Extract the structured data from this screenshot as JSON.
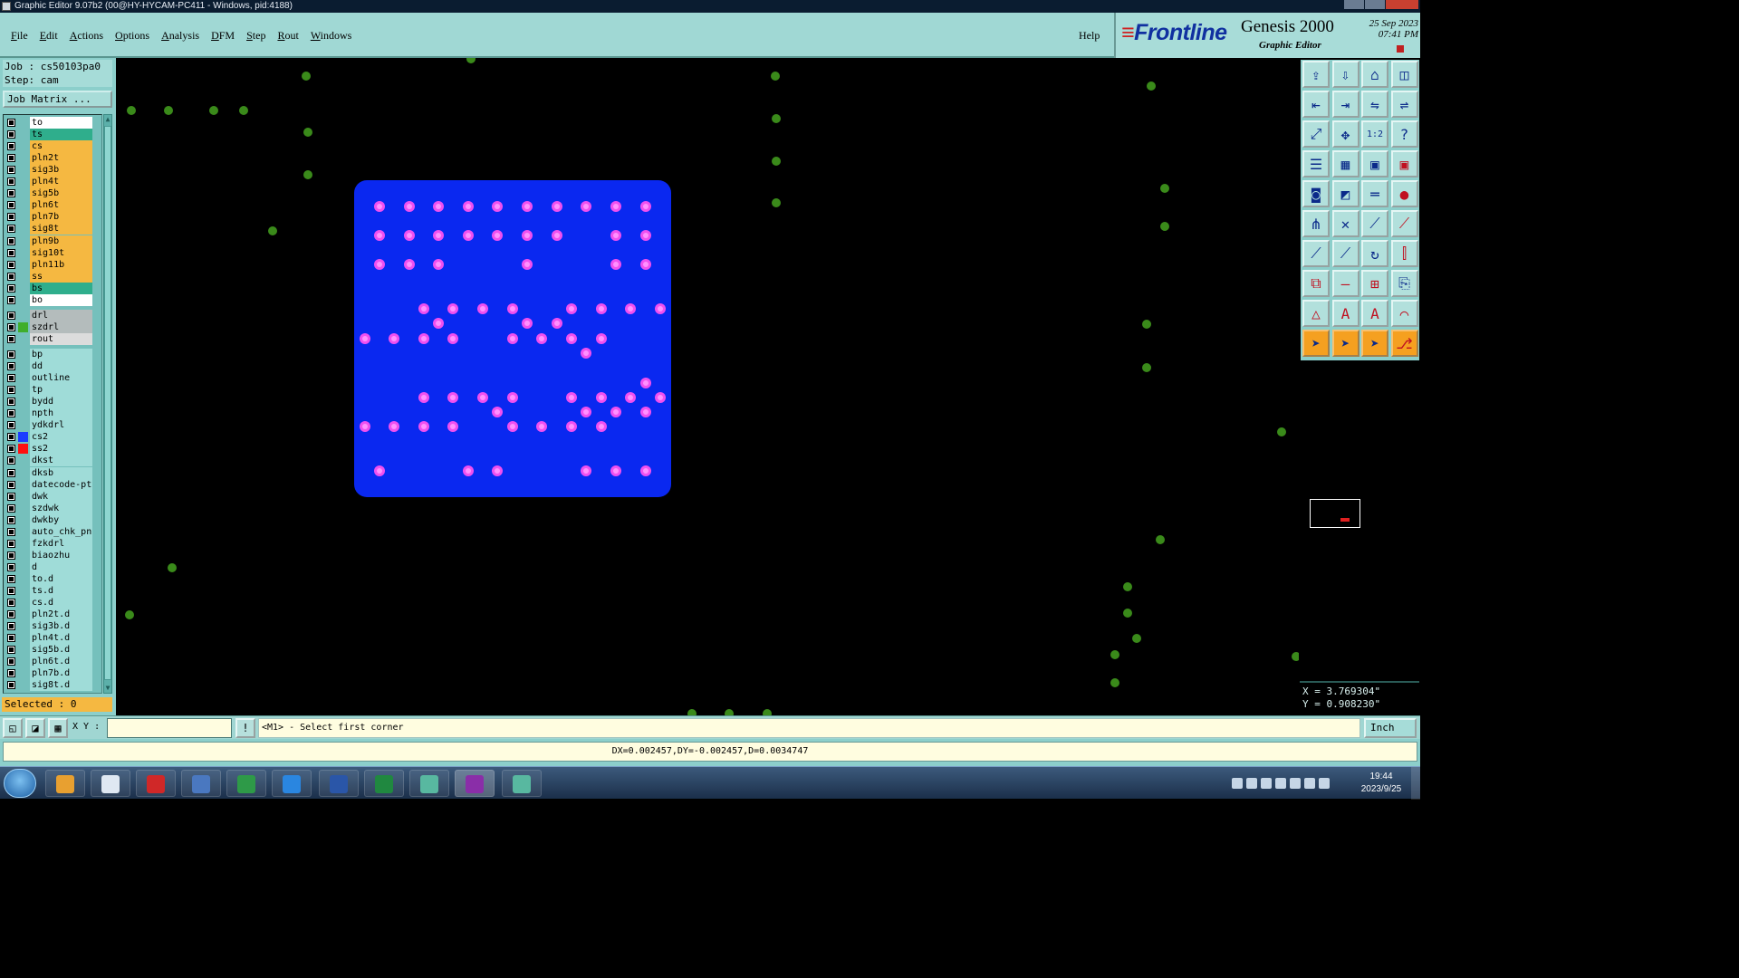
{
  "window": {
    "title": "Graphic Editor 9.07b2 (00@HY-HYCAM-PC411 - Windows, pid:4188)"
  },
  "menu": {
    "items": [
      "File",
      "Edit",
      "Actions",
      "Options",
      "Analysis",
      "DFM",
      "Step",
      "Rout",
      "Windows"
    ],
    "help": "Help"
  },
  "brand": {
    "logo": "Frontline",
    "product": "Genesis 2000",
    "subtitle": "Graphic Editor",
    "date_line1": "25 Sep 2023",
    "date_line2": "07:41 PM"
  },
  "job": {
    "job_label": "Job : cs50103pa0",
    "step_label": "Step: cam",
    "matrix_button": "Job Matrix ..."
  },
  "layers": [
    {
      "name": "to",
      "bg": "#ffffff",
      "swatch": ""
    },
    {
      "name": "ts",
      "bg": "#2fae8c",
      "swatch": ""
    },
    {
      "name": "cs",
      "bg": "#f5b841",
      "swatch": ""
    },
    {
      "name": "pln2t",
      "bg": "#f5b841",
      "swatch": ""
    },
    {
      "name": "sig3b",
      "bg": "#f5b841",
      "swatch": ""
    },
    {
      "name": "pln4t",
      "bg": "#f5b841",
      "swatch": ""
    },
    {
      "name": "sig5b",
      "bg": "#f5b841",
      "swatch": ""
    },
    {
      "name": "pln6t",
      "bg": "#f5b841",
      "swatch": ""
    },
    {
      "name": "pln7b",
      "bg": "#f5b841",
      "swatch": ""
    },
    {
      "name": "sig8t",
      "bg": "#f5b841",
      "swatch": ""
    },
    {
      "name": "pln9b",
      "bg": "#f5b841",
      "swatch": ""
    },
    {
      "name": "sig10t",
      "bg": "#f5b841",
      "swatch": ""
    },
    {
      "name": "pln11b",
      "bg": "#f5b841",
      "swatch": ""
    },
    {
      "name": "ss",
      "bg": "#f5b841",
      "swatch": ""
    },
    {
      "name": "bs",
      "bg": "#2fae8c",
      "swatch": ""
    },
    {
      "name": "bo",
      "bg": "#ffffff",
      "swatch": ""
    },
    {
      "name": "drl",
      "bg": "#b4bcbc",
      "swatch": ""
    },
    {
      "name": "szdrl",
      "bg": "#b4bcbc",
      "swatch": "#3fae2c"
    },
    {
      "name": "rout",
      "bg": "#dcdcdc",
      "swatch": ""
    },
    {
      "name": "bp",
      "bg": "#9fdcd8",
      "swatch": ""
    },
    {
      "name": "dd",
      "bg": "#9fdcd8",
      "swatch": ""
    },
    {
      "name": "outline",
      "bg": "#9fdcd8",
      "swatch": ""
    },
    {
      "name": "tp",
      "bg": "#9fdcd8",
      "swatch": ""
    },
    {
      "name": "bydd",
      "bg": "#9fdcd8",
      "swatch": ""
    },
    {
      "name": "npth",
      "bg": "#9fdcd8",
      "swatch": ""
    },
    {
      "name": "ydkdrl",
      "bg": "#9fdcd8",
      "swatch": ""
    },
    {
      "name": "cs2",
      "bg": "#9fdcd8",
      "swatch": "#1a3cff"
    },
    {
      "name": "ss2",
      "bg": "#9fdcd8",
      "swatch": "#ff1010"
    },
    {
      "name": "dkst",
      "bg": "#9fdcd8",
      "swatch": ""
    },
    {
      "name": "dksb",
      "bg": "#9fdcd8",
      "swatch": ""
    },
    {
      "name": "datecode-pt",
      "bg": "#9fdcd8",
      "swatch": ""
    },
    {
      "name": "dwk",
      "bg": "#9fdcd8",
      "swatch": ""
    },
    {
      "name": "szdwk",
      "bg": "#9fdcd8",
      "swatch": ""
    },
    {
      "name": "dwkby",
      "bg": "#9fdcd8",
      "swatch": ""
    },
    {
      "name": "auto_chk_pn",
      "bg": "#9fdcd8",
      "swatch": ""
    },
    {
      "name": "fzkdrl",
      "bg": "#9fdcd8",
      "swatch": ""
    },
    {
      "name": "biaozhu",
      "bg": "#9fdcd8",
      "swatch": ""
    },
    {
      "name": "d",
      "bg": "#9fdcd8",
      "swatch": ""
    },
    {
      "name": "to.d",
      "bg": "#9fdcd8",
      "swatch": ""
    },
    {
      "name": "ts.d",
      "bg": "#9fdcd8",
      "swatch": ""
    },
    {
      "name": "cs.d",
      "bg": "#9fdcd8",
      "swatch": ""
    },
    {
      "name": "pln2t.d",
      "bg": "#9fdcd8",
      "swatch": ""
    },
    {
      "name": "sig3b.d",
      "bg": "#9fdcd8",
      "swatch": ""
    },
    {
      "name": "pln4t.d",
      "bg": "#9fdcd8",
      "swatch": ""
    },
    {
      "name": "sig5b.d",
      "bg": "#9fdcd8",
      "swatch": ""
    },
    {
      "name": "pln6t.d",
      "bg": "#9fdcd8",
      "swatch": ""
    },
    {
      "name": "pln7b.d",
      "bg": "#9fdcd8",
      "swatch": ""
    },
    {
      "name": "sig8t.d",
      "bg": "#9fdcd8",
      "swatch": ""
    }
  ],
  "selected": "Selected : 0",
  "colors": {
    "board_fill": "#0a28f0",
    "pad_fill": "#f050f0",
    "pad_core": "#ff90ff",
    "drill_dot": "#3a8a1a",
    "canvas_bg": "#000000"
  },
  "coords": {
    "x": "X = 3.769304\"",
    "y": "Y = 0.908230\""
  },
  "command": {
    "xy_label": "X Y :",
    "xy_value": "",
    "prompt": "<M1> - Select first corner",
    "unit": "Inch"
  },
  "status": {
    "measure": "DX=0.002457,DY=-0.002457,D=0.0034747"
  },
  "taskbar": {
    "time": "19:44",
    "date": "2023/9/25"
  },
  "tools": {
    "icons": [
      "open-step-icon",
      "save-icon",
      "home-icon",
      "window-split-icon",
      "move-left-icon",
      "move-right-icon",
      "flip-icon",
      "align-icon",
      "fit-icon",
      "zoom-center-icon",
      "ratio-icon",
      "help-icon",
      "layers-icon",
      "grid-icon",
      "feature-filter-icon",
      "filter-red-icon",
      "camera-icon",
      "resize-icon",
      "ruler-icon",
      "pad-icon",
      "connect-icon",
      "cross-icon",
      "line-node-icon",
      "line-node-red-icon",
      "edit-line-icon",
      "edit-diag-icon",
      "arc-icon",
      "split-icon",
      "snap-icon",
      "minus-icon",
      "measure-icon",
      "copy-icon",
      "triangle-icon",
      "A-icon",
      "A-outline-icon",
      "arch-icon",
      "select-pointer-icon",
      "select-pointer-alt-icon",
      "select-pointer-red-icon",
      "select-net-icon"
    ]
  }
}
